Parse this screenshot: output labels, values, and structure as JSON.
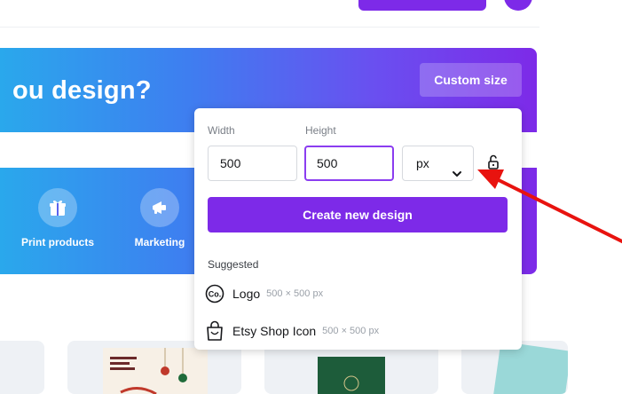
{
  "hero": {
    "title": "ou design?",
    "custom_size_label": "Custom size",
    "categories": [
      {
        "label": "Print products",
        "icon": "gift-icon"
      },
      {
        "label": "Marketing",
        "icon": "megaphone-icon"
      }
    ]
  },
  "custom_size_panel": {
    "width_label": "Width",
    "height_label": "Height",
    "width_value": "500",
    "height_value": "500",
    "unit_value": "px",
    "lock_icon": "unlocked-padlock-icon",
    "create_label": "Create new design",
    "suggested_label": "Suggested",
    "suggestions": [
      {
        "name": "Logo",
        "dims": "500 × 500 px",
        "icon": "logo-co-icon"
      },
      {
        "name": "Etsy Shop Icon",
        "dims": "500 × 500 px",
        "icon": "shopping-bag-icon"
      }
    ]
  },
  "annotation": {
    "color": "#e8130f",
    "icon": "red-arrow-pointing-to-unit-dropdown"
  },
  "colors": {
    "brand_purple": "#7d2ae8",
    "hero_gradient_start": "#2aa8ec",
    "hero_gradient_end": "#7d2ae8"
  }
}
